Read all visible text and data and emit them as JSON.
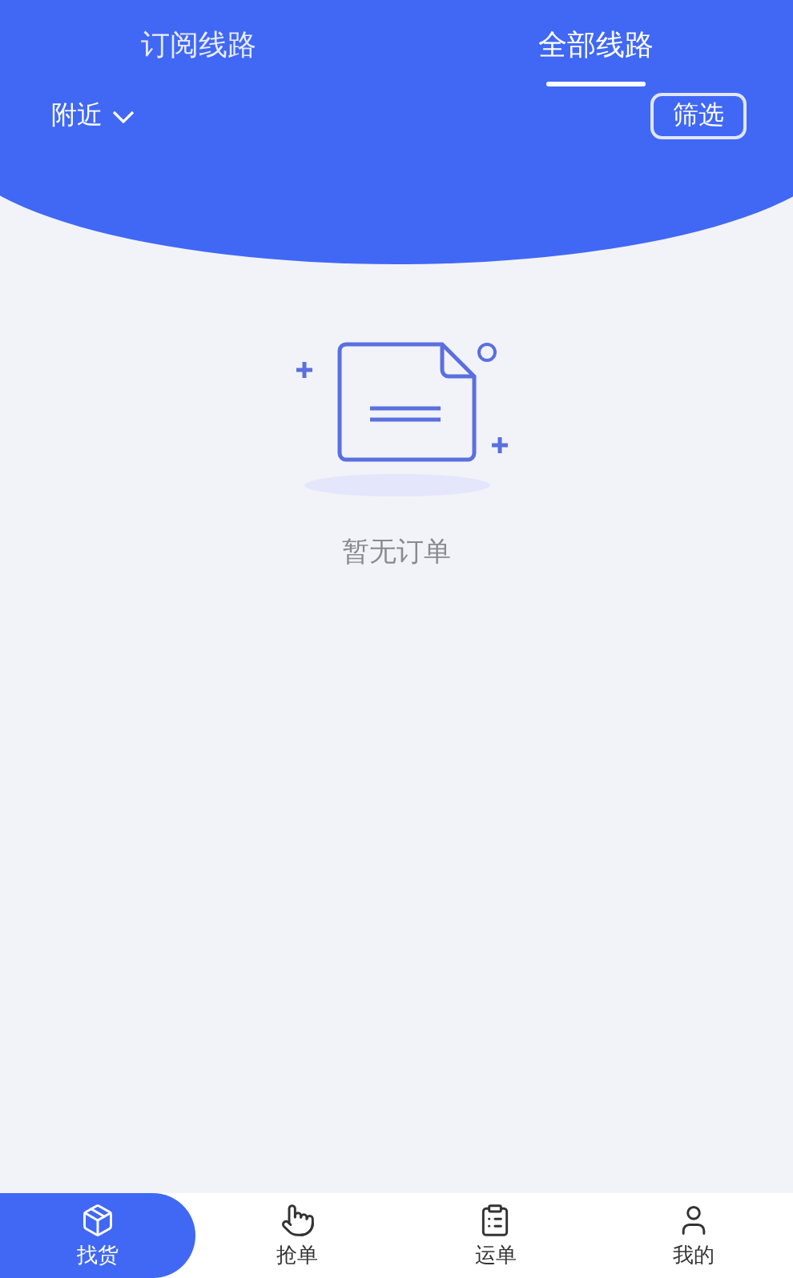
{
  "tabs": [
    {
      "label": "订阅线路",
      "selected": false
    },
    {
      "label": "全部线路",
      "selected": true
    }
  ],
  "location": {
    "label": "附近"
  },
  "filter_button": "筛选",
  "empty_state": {
    "message": "暂无订单"
  },
  "bottom_nav": [
    {
      "label": "找货",
      "selected": true
    },
    {
      "label": "抢单",
      "selected": false
    },
    {
      "label": "运单",
      "selected": false
    },
    {
      "label": "我的",
      "selected": false
    }
  ]
}
